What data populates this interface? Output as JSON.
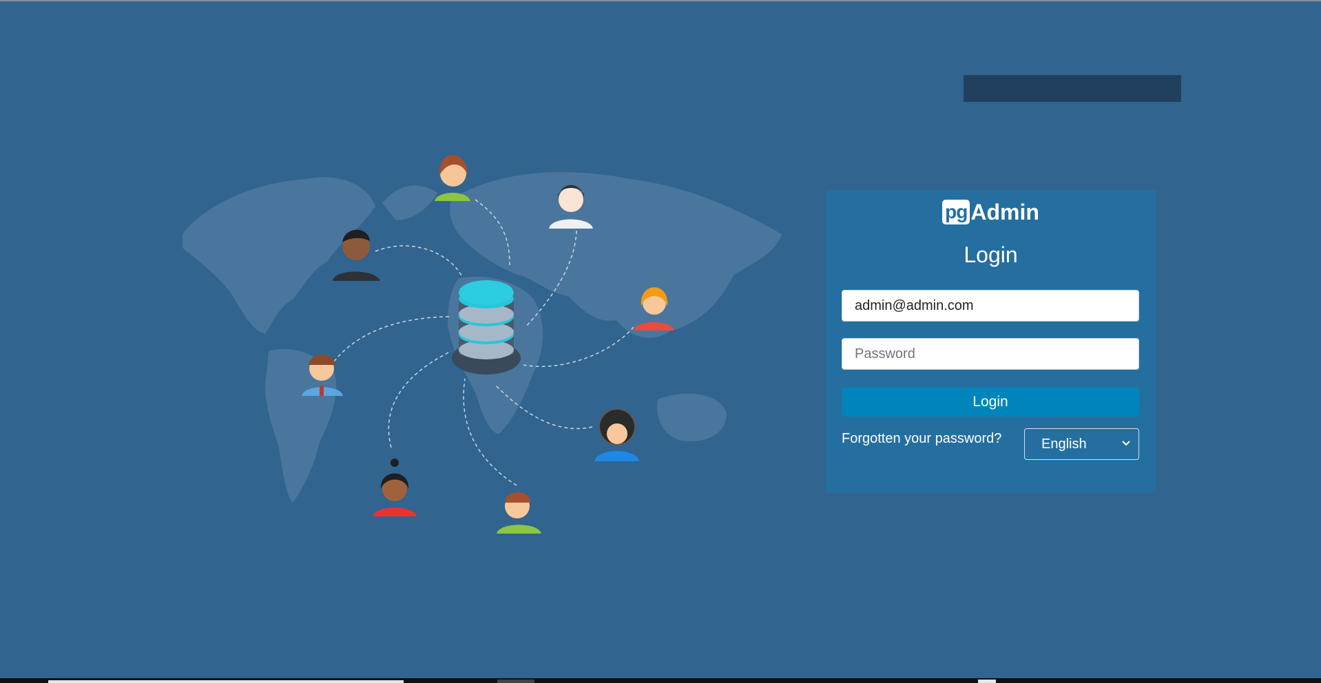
{
  "logo": {
    "pg": "pg",
    "admin": "Admin"
  },
  "login": {
    "title": "Login",
    "email_value": "admin@admin.com",
    "password_placeholder": "Password",
    "button_label": "Login",
    "forgot_link": "Forgotten your password?",
    "language": "English"
  },
  "colors": {
    "background": "#31648f",
    "panel": "#246fa0",
    "button": "#0085bb",
    "alert_bar": "#21405e"
  },
  "icons": [
    "world-map",
    "database-icon",
    "user-avatar-icon",
    "chevron-down-icon"
  ]
}
